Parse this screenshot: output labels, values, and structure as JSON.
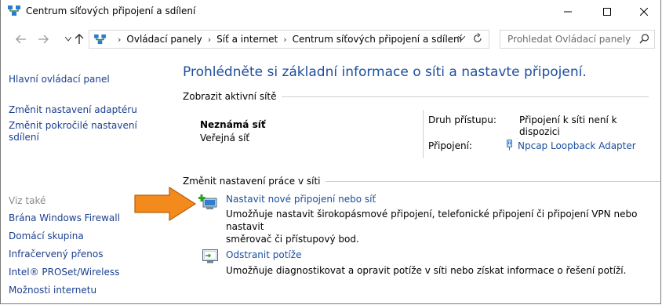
{
  "window": {
    "title": "Centrum síťových připojení a sdílení",
    "minimize_glyph": "—",
    "maximize_glyph": "☐",
    "close_glyph": "✕"
  },
  "address": {
    "breadcrumbs": [
      "Ovládací panely",
      "Síť a internet",
      "Centrum síťových připojení a sdílení"
    ],
    "search_placeholder": "Prohledat Ovládací panely"
  },
  "sidebar": {
    "top_links": [
      "Hlavní ovládací panel",
      "Změnit nastavení adaptéru",
      "Změnit pokročilé nastavení",
      "sdílení"
    ],
    "see_also_label": "Viz také",
    "see_also_links": [
      "Brána Windows Firewall",
      "Domácí skupina",
      "Infračervený přenos",
      "Intel® PROSet/Wireless",
      "Možnosti internetu"
    ]
  },
  "main": {
    "heading": "Prohlédněte si základní informace o síti a nastavte připojení.",
    "active_networks_label": "Zobrazit aktivní sítě",
    "network": {
      "name": "Neznámá síť",
      "category": "Veřejná síť",
      "access_label": "Druh přístupu:",
      "access_value_1": "Připojení k síti není k",
      "access_value_2": "dispozici",
      "connection_label": "Připojení:",
      "connection_value": "Npcap Loopback Adapter"
    },
    "change_settings_label": "Změnit nastavení práce v síti",
    "tasks": [
      {
        "title": "Nastavit nové připojení nebo síť",
        "desc_1": "Umožňuje nastavit širokopásmové připojení, telefonické připojení či připojení VPN nebo nastavit",
        "desc_2": "směrovač či přístupový bod."
      },
      {
        "title": "Odstranit potíže",
        "desc_1": "Umožňuje diagnostikovat a opravit potíže v síti nebo získat informace o řešení potíží."
      }
    ]
  },
  "colors": {
    "link": "#1a3f8f",
    "heading": "#1e4e9d",
    "arrow": "#f28a1c"
  },
  "icons": [
    "network-center-icon",
    "back-arrow-icon",
    "forward-arrow-icon",
    "up-arrow-icon",
    "search-icon",
    "refresh-icon",
    "adapter-icon",
    "new-connection-icon",
    "troubleshoot-icon",
    "orange-arrow-icon"
  ]
}
